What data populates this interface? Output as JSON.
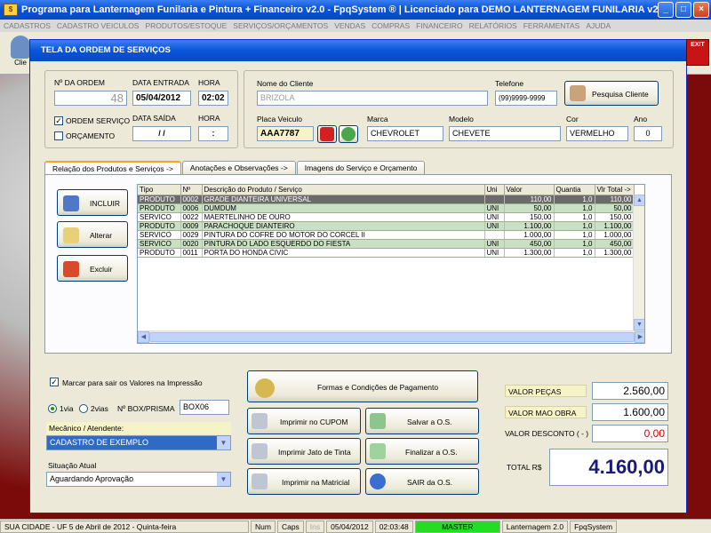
{
  "app": {
    "title": "Programa para Lanternagem Funilaria e Pintura + Financeiro v2.0 - FpqSystem ® | Licenciado para  DEMO LANTERNAGEM FUNILARIA v2.0 - 30091...",
    "menu": [
      "CADASTROS",
      "CADASTRO VEICULOS",
      "PRODUTOS/ESTOQUE",
      "SERVIÇOS/ORÇAMENTOS",
      "VENDAS",
      "COMPRAS",
      "FINANCEIRO",
      "RELATÓRIOS",
      "FERRAMENTAS",
      "AJUDA"
    ],
    "toolbar_clients_label": "Clie",
    "exit_label": "EXIT"
  },
  "dialog": {
    "title": "TELA DA ORDEM DE SERVIÇOS",
    "order": {
      "number_label": "Nº DA ORDEM",
      "number": "48",
      "entry_date_label": "DATA ENTRADA",
      "entry_date": "05/04/2012",
      "entry_time_label": "HORA",
      "entry_time": "02:02",
      "exit_date_label": "DATA SAÍDA",
      "exit_date": " / /",
      "exit_time_label": "HORA",
      "exit_time": ":",
      "ordem_servico_label": "ORDEM SERVIÇO",
      "ordem_servico_checked": true,
      "orcamento_label": "ORÇAMENTO",
      "orcamento_checked": false
    },
    "client": {
      "name_label": "Nome do Cliente",
      "name": "BRIZOLA",
      "phone_label": "Telefone",
      "phone": "(99)9999-9999",
      "search_button": "Pesquisa Cliente",
      "plate_label": "Placa Veiculo",
      "plate": "AAA7787",
      "brand_label": "Marca",
      "brand": "CHEVROLET",
      "model_label": "Modelo",
      "model": "CHEVETE",
      "color_label": "Cor",
      "color": "VERMELHO",
      "year_label": "Ano",
      "year": "0"
    },
    "tabs": [
      "Relação dos Produtos e Serviços ->",
      "Anotações e Observações ->",
      "Imagens do Serviço e Orçamento"
    ],
    "actions": {
      "add": "INCLUIR",
      "edit": "Alterar",
      "delete": "Excluir"
    },
    "grid": {
      "columns": [
        "Tipo",
        "Nº",
        "Descrição do Produto / Serviço",
        "Uni",
        "Valor",
        "Quantia",
        "Vlr Total ->"
      ],
      "rows": [
        [
          "PRODUTO",
          "0002",
          "GRADE DIANTEIRA UNIVERSAL",
          "",
          "110,00",
          "1,0",
          "110,00"
        ],
        [
          "PRODUTO",
          "0006",
          "DUMDUM",
          "UNI",
          "50,00",
          "1,0",
          "50,00"
        ],
        [
          "SERVICO",
          "0022",
          "MAERTELINHO DE OURO",
          "UNI",
          "150,00",
          "1,0",
          "150,00"
        ],
        [
          "PRODUTO",
          "0009",
          "PARACHOQUE DIANTEIRO",
          "UNI",
          "1.100,00",
          "1,0",
          "1.100,00"
        ],
        [
          "SERVICO",
          "0029",
          "PINTURA DO COFRE DO MOTOR DO CORCEL II",
          "",
          "1.000,00",
          "1,0",
          "1.000,00"
        ],
        [
          "SERVICO",
          "0020",
          "PINTURA DO LADO ESQUERDO DO FIESTA",
          "UNI",
          "450,00",
          "1,0",
          "450,00"
        ],
        [
          "PRODUTO",
          "0011",
          "PORTA DO HONDA CIVIC",
          "UNI",
          "1.300,00",
          "1,0",
          "1.300,00"
        ]
      ]
    },
    "print_options": {
      "mark_values_label": "Marcar para sair os Valores na Impressão",
      "mark_values_checked": true,
      "via1_label": "1via",
      "via2_label": "2vias",
      "box_label": "Nº BOX/PRISMA",
      "box_value": "BOX06"
    },
    "mechanic_label": "Mecânico / Atendente:",
    "mechanic": "CADASTRO DE EXEMPLO",
    "situation_label": "Situação Atual",
    "situation": "Aguardando Aprovação",
    "buttons": {
      "payment": "Formas e Condições de Pagamento",
      "print_cupom": "Imprimir no CUPOM",
      "save": "Salvar a O.S.",
      "print_inkjet": "Imprimir Jato de Tinta",
      "finalize": "Finalizar a O.S.",
      "print_matrix": "Imprimir na Matricial",
      "exit": "SAIR da O.S."
    },
    "totals": {
      "parts_label": "VALOR PEÇAS",
      "parts": "2.560,00",
      "labor_label": "VALOR MAO OBRA",
      "labor": "1.600,00",
      "discount_label": "VALOR DESCONTO ( - )",
      "discount": "0,00",
      "total_label": "TOTAL R$",
      "total": "4.160,00"
    }
  },
  "statusbar": {
    "city": "SUA CIDADE - UF  5 de Abril de 2012 - Quinta-feira",
    "num": "Num",
    "caps": "Caps",
    "ins": "Ins",
    "date": "05/04/2012",
    "time": "02:03:48",
    "user": "MASTER",
    "version": "Lanternagem 2.0",
    "brand": "FpqSystem"
  },
  "colors": {
    "titlebar": "#0a55d8",
    "selected_row": "#6b6b6b",
    "alt_row": "#c9e0c4",
    "total_value": "#1a1a7a",
    "discount_value": "#d40000",
    "master_bg": "#22dd22"
  }
}
